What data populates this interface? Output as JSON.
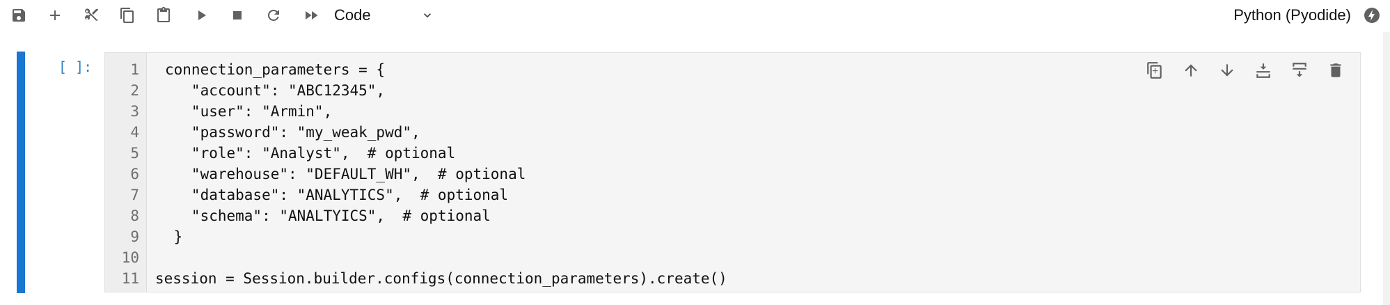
{
  "toolbar": {
    "cell_type": "Code",
    "kernel_name": "Python (Pyodide)"
  },
  "cell": {
    "prompt": "[ ]:",
    "line_numbers": [
      "1",
      "2",
      "3",
      "4",
      "5",
      "6",
      "7",
      "8",
      "9",
      "10",
      "11"
    ],
    "lines": [
      "connection_parameters = {",
      "   \"account\": \"ABC12345\",",
      "   \"user\": \"Armin\",",
      "   \"password\": \"my_weak_pwd\",",
      "   \"role\": \"Analyst\",  # optional",
      "   \"warehouse\": \"DEFAULT_WH\",  # optional",
      "   \"database\": \"ANALYTICS\",  # optional",
      "   \"schema\": \"ANALTYICS\",  # optional",
      " }",
      "",
      "session = Session.builder.configs(connection_parameters).create()"
    ]
  },
  "colors": {
    "accent": "#1976d2",
    "prompt": "#307fc1",
    "editor_bg": "#f5f5f5"
  }
}
